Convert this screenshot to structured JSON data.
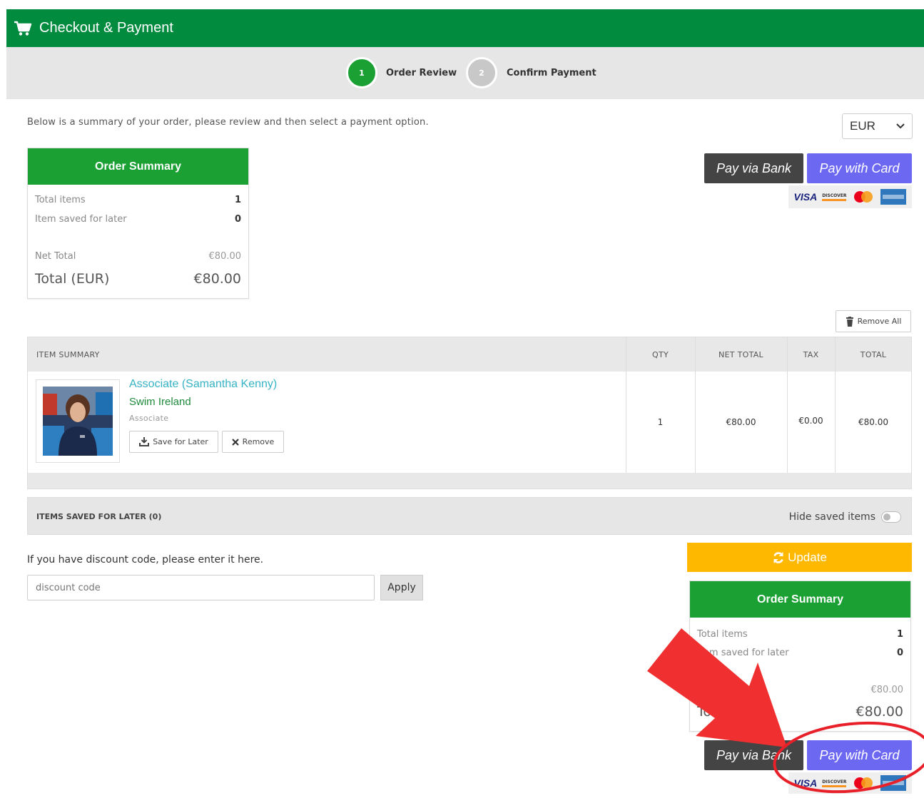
{
  "header": {
    "title": "Checkout & Payment",
    "icon": "cart-icon"
  },
  "steps": [
    {
      "number": "1",
      "label": "Order Review",
      "color": "#1aa033"
    },
    {
      "number": "2",
      "label": "Confirm Payment",
      "color": "#c8c8c8"
    }
  ],
  "intro": "Below is a summary of your order, please review and then select a payment option.",
  "currency": {
    "selected": "EUR"
  },
  "summary": {
    "title": "Order Summary",
    "total_items_label": "Total items",
    "total_items_value": "1",
    "saved_label": "Item saved for later",
    "saved_value": "0",
    "net_total_label": "Net Total",
    "net_total_value": "€80.00",
    "total_label": "Total (EUR)",
    "total_value": "€80.00"
  },
  "payment": {
    "bank_label": "Pay via Bank",
    "card_label": "Pay with Card",
    "cards": [
      "VISA",
      "DISCOVER"
    ]
  },
  "remove_all_label": "Remove All",
  "table": {
    "headers": {
      "item": "ITEM SUMMARY",
      "qty": "QTY",
      "net": "NET TOTAL",
      "tax": "TAX",
      "total": "TOTAL"
    },
    "row": {
      "title": "Associate (Samantha Kenny)",
      "org": "Swim Ireland",
      "type": "Associate",
      "save_label": "Save for Later",
      "remove_label": "Remove",
      "qty": "1",
      "net": "€80.00",
      "tax": "€0.00",
      "total": "€80.00"
    }
  },
  "saved": {
    "title": "ITEMS SAVED FOR LATER (0)",
    "toggle_label": "Hide saved items"
  },
  "discount": {
    "label": "If you have discount code, please enter it here.",
    "placeholder": "discount code",
    "apply_label": "Apply"
  },
  "update_label": "Update",
  "annotation": {
    "arrow_color": "#f03030",
    "circle_color": "#e8202a"
  }
}
